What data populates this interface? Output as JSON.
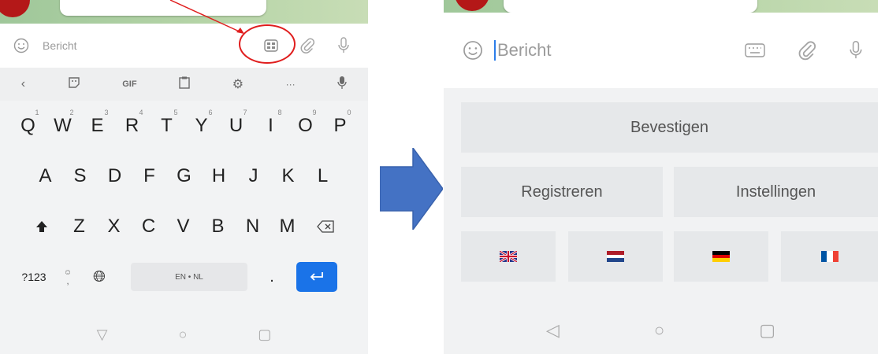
{
  "left": {
    "input_placeholder": "Bericht",
    "toolbar": {
      "gif_label": "GIF",
      "more_label": "···"
    },
    "keys": {
      "row1": [
        "Q",
        "W",
        "E",
        "R",
        "T",
        "Y",
        "U",
        "I",
        "O",
        "P"
      ],
      "row1_hints": [
        "1",
        "2",
        "3",
        "4",
        "5",
        "6",
        "7",
        "8",
        "9",
        "0"
      ],
      "row2": [
        "A",
        "S",
        "D",
        "F",
        "G",
        "H",
        "J",
        "K",
        "L"
      ],
      "row3": [
        "Z",
        "X",
        "C",
        "V",
        "B",
        "N",
        "M"
      ],
      "symbols_label": "?123",
      "space_label": "EN • NL",
      "period_label": "."
    }
  },
  "right": {
    "input_placeholder": "Bericht",
    "buttons": {
      "confirm": "Bevestigen",
      "register": "Registreren",
      "settings": "Instellingen"
    },
    "language_flags": [
      "uk-flag-icon",
      "nl-flag-icon",
      "de-flag-icon",
      "fr-flag-icon"
    ]
  },
  "colors": {
    "annotation": "#e01e1e",
    "arrow": "#4472c4",
    "enter_key": "#1a73e8",
    "chat_header": "#9fc79a",
    "avatar": "#b41818"
  }
}
